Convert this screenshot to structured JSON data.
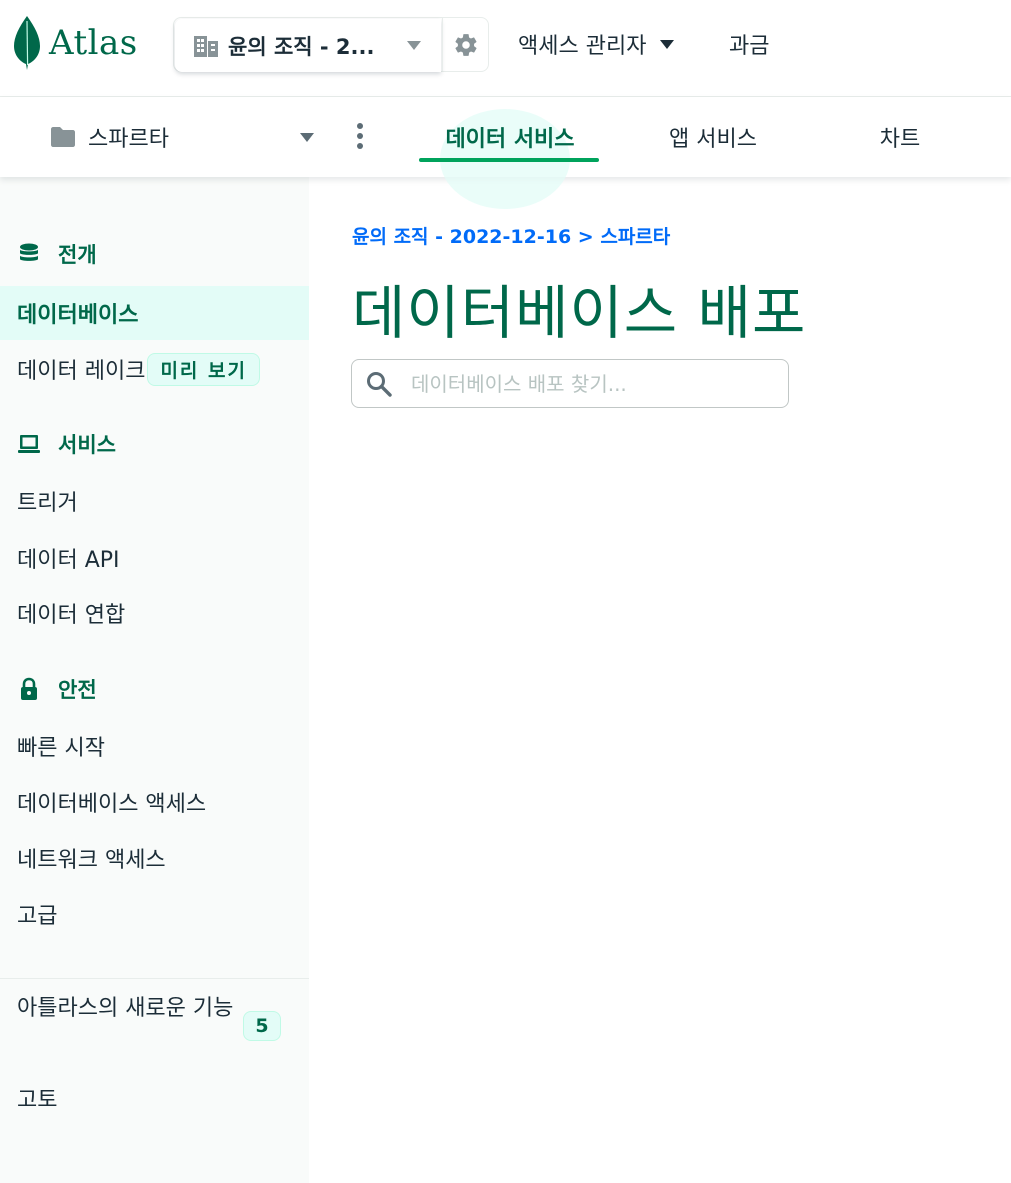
{
  "app": {
    "logo_text": "Atlas",
    "brand_color": "#00684a",
    "accent_color": "#00a35c",
    "link_color": "#016bf8"
  },
  "topbar": {
    "org_name": "윤의 조직 - 2...",
    "access_manager": "액세스 관리자",
    "billing": "과금"
  },
  "projectbar": {
    "project_name": "스파르타",
    "tabs": [
      {
        "label": "데이터 서비스",
        "active": true
      },
      {
        "label": "앱 서비스",
        "active": false
      },
      {
        "label": "차트",
        "active": false
      }
    ]
  },
  "sidebar": {
    "sections": [
      {
        "label": "전개",
        "icon": "database-icon"
      },
      {
        "label": "서비스",
        "icon": "laptop-icon"
      },
      {
        "label": "안전",
        "icon": "lock-icon"
      }
    ],
    "items": {
      "databases": "데이터베이스",
      "data_lake": "데이터 레이크",
      "data_lake_badge": "미리 보기",
      "triggers": "트리거",
      "data_api": "데이터 API",
      "data_federation": "데이터 연합",
      "quick_start": "빠른 시작",
      "database_access": "데이터베이스 액세스",
      "network_access": "네트워크 액세스",
      "advanced": "고급",
      "whats_new": "아틀라스의 새로운 기능",
      "whats_new_count": "5",
      "feedback": "고토"
    }
  },
  "main": {
    "breadcrumb": "윤의 조직 - 2022-12-16 > 스파르타",
    "title": "데이터베이스 배포",
    "search_placeholder": "데이터베이스 배포 찾기..."
  }
}
